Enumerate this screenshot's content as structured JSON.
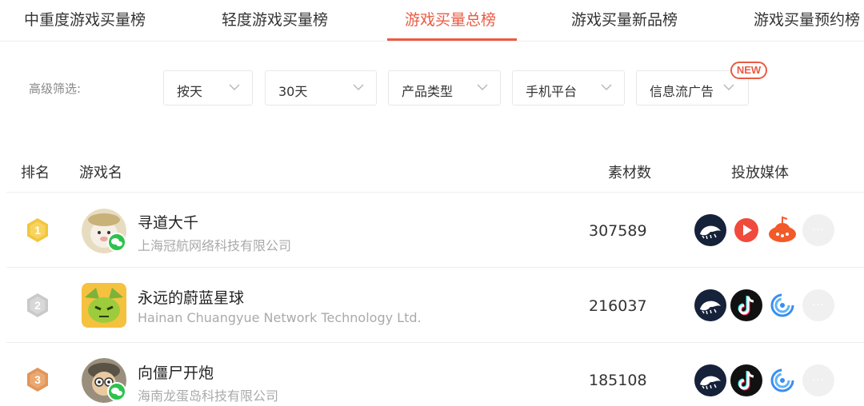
{
  "tabs": [
    {
      "label": "中重度游戏买量榜",
      "active": false
    },
    {
      "label": "轻度游戏买量榜",
      "active": false
    },
    {
      "label": "游戏买量总榜",
      "active": true
    },
    {
      "label": "游戏买量新品榜",
      "active": false
    },
    {
      "label": "游戏买量预约榜",
      "active": false
    }
  ],
  "filters": {
    "label": "高级筛选:",
    "selects": [
      {
        "value": "按天"
      },
      {
        "value": "30天"
      },
      {
        "value": "产品类型"
      },
      {
        "value": "手机平台"
      },
      {
        "value": "信息流广告",
        "badge": "NEW"
      }
    ]
  },
  "table": {
    "headers": {
      "rank": "排名",
      "game": "游戏名",
      "assets": "素材数",
      "media": "投放媒体"
    },
    "rows": [
      {
        "rank": "1",
        "rank_color": "#f3c53c",
        "name": "寻道大千",
        "company": "上海冠航网络科技有限公司",
        "count": "307589",
        "wechat": true,
        "media": [
          "whale-icon",
          "red-play-icon",
          "orange-ufo-icon",
          "more-icon"
        ]
      },
      {
        "rank": "2",
        "rank_color": "#c9c9c9",
        "name": "永远的蔚蓝星球",
        "company": "Hainan Chuangyue Network Technology Ltd.",
        "count": "216037",
        "wechat": false,
        "media": [
          "whale-icon",
          "tiktok-icon",
          "blue-rings-icon",
          "more-icon"
        ]
      },
      {
        "rank": "3",
        "rank_color": "#e2955a",
        "name": "向僵尸开炮",
        "company": "海南龙蛋岛科技有限公司",
        "count": "185108",
        "wechat": true,
        "media": [
          "whale-icon",
          "tiktok-icon",
          "blue-rings-icon",
          "more-icon"
        ]
      }
    ]
  },
  "colors": {
    "accent": "#ea5b43",
    "gold": "#f3c53c",
    "silver": "#c9c9c9",
    "bronze": "#e2955a",
    "wechat_green": "#2dc24c"
  }
}
